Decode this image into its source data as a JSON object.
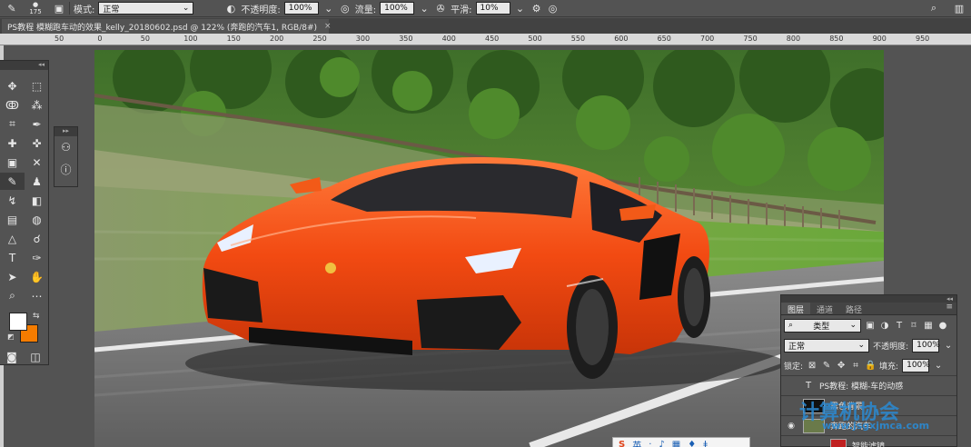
{
  "options_bar": {
    "brush_size": "175",
    "mode_label": "模式:",
    "mode_value": "正常",
    "opacity_label": "不透明度:",
    "opacity_value": "100%",
    "flow_label": "流量:",
    "flow_value": "100%",
    "smoothing_label": "平滑:",
    "smoothing_value": "10%"
  },
  "document_tab": {
    "title": "PS教程 模糊跑车动的效果_kelly_20180602.psd @ 122% (奔跑的汽车1, RGB/8#)",
    "close": "×"
  },
  "ruler": {
    "ticks": [
      "50",
      "0",
      "50",
      "100",
      "150",
      "200",
      "250",
      "300",
      "350",
      "400",
      "450",
      "500",
      "550",
      "600",
      "650",
      "700",
      "750",
      "800",
      "850",
      "900",
      "950"
    ]
  },
  "layers_panel": {
    "tabs": [
      "图层",
      "通道",
      "路径"
    ],
    "filter_kind": "类型",
    "blend_mode": "正常",
    "opacity_label": "不透明度:",
    "opacity_value": "100%",
    "lock_label": "锁定:",
    "fill_label": "填充:",
    "fill_value": "100%",
    "layers": [
      {
        "name": "PS教程: 模糊-车的动感",
        "type": "T"
      },
      {
        "name": "黑色背景",
        "type": "thumb"
      },
      {
        "name": "奔跑的汽车",
        "type": "thumb"
      },
      {
        "name": "智能滤镜",
        "type": "fx"
      }
    ]
  },
  "watermark": {
    "title": "计算机协会",
    "url": "www.jsgxjmca.com"
  },
  "ime": {
    "items": [
      "英",
      "·",
      "♪",
      "▦",
      "♦",
      "ǂ"
    ]
  },
  "colors": {
    "foreground": "#ffffff",
    "background": "#f57c00"
  }
}
